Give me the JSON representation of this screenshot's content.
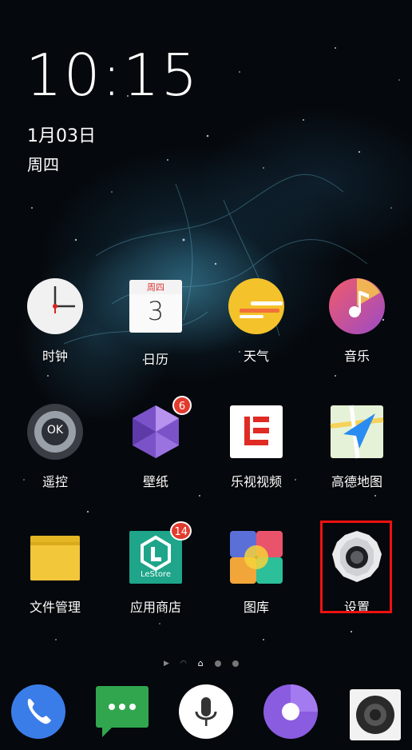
{
  "lockscreen": {
    "time": "10:15",
    "date": "1月03日",
    "weekday": "周四"
  },
  "apps": [
    {
      "label": "时钟",
      "icon": "clock-icon"
    },
    {
      "label": "日历",
      "icon": "calendar-icon",
      "calendar_weekday": "周四",
      "calendar_day": "3"
    },
    {
      "label": "天气",
      "icon": "weather-icon"
    },
    {
      "label": "音乐",
      "icon": "music-icon"
    },
    {
      "label": "遥控",
      "icon": "remote-icon",
      "remote_text": "OK"
    },
    {
      "label": "壁纸",
      "icon": "wallpaper-icon",
      "badge": "6"
    },
    {
      "label": "乐视视频",
      "icon": "letv-video-icon"
    },
    {
      "label": "高德地图",
      "icon": "amap-icon"
    },
    {
      "label": "文件管理",
      "icon": "folder-icon"
    },
    {
      "label": "应用商店",
      "icon": "lestore-icon",
      "badge": "14",
      "store_text": "LeStore"
    },
    {
      "label": "图库",
      "icon": "gallery-icon"
    },
    {
      "label": "设置",
      "icon": "settings-gear-icon",
      "highlighted": true
    }
  ],
  "dock": [
    {
      "icon": "phone-icon"
    },
    {
      "icon": "messages-icon"
    },
    {
      "icon": "voice-assistant-icon"
    },
    {
      "icon": "browser-icon"
    },
    {
      "icon": "camera-icon"
    }
  ],
  "colors": {
    "highlight_border": "#ee1111",
    "badge": "#e23b2e"
  }
}
